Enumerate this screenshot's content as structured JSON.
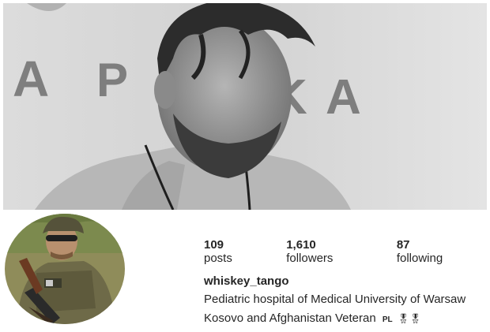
{
  "banner": {
    "background_text": "A POLSKA",
    "description": ""
  },
  "profile": {
    "stats": {
      "posts_count": "109",
      "posts_label": "posts",
      "followers_count": "1,610",
      "followers_label": "followers",
      "following_count": "87",
      "following_label": "following"
    },
    "username": "whiskey_tango",
    "bio_line1": "Pediatric hospital of Medical University of Warsaw",
    "bio_line2": "Kosovo and Afghanistan Veteran",
    "bio_flag": "PL",
    "bio_medals": "🎖🎖"
  },
  "colors": {
    "text": "#262626",
    "background": "#ffffff"
  }
}
